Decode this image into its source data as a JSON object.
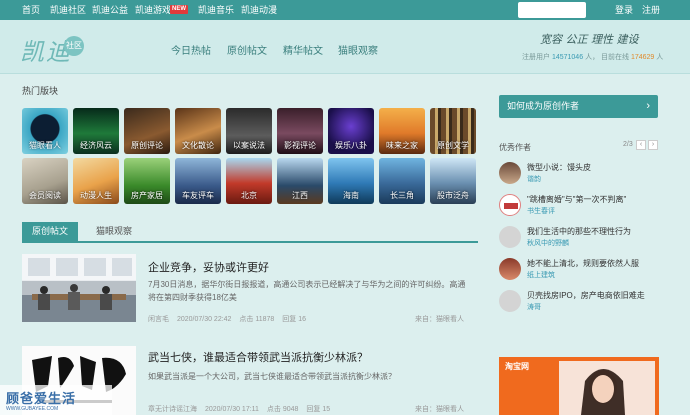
{
  "topnav": {
    "items": [
      "首页",
      "凯迪社区",
      "凯迪公益",
      "凯迪游戏",
      "凯迪音乐",
      "凯迪动漫"
    ],
    "new_badge": "NEW",
    "login": "登录",
    "register": "注册"
  },
  "header": {
    "logo_text": "凯迪",
    "logo_badge": "社区",
    "nav": [
      "今日热帖",
      "原创帖文",
      "精华帖文",
      "猫眼观察"
    ],
    "slogan": "宽容 公正 理性 建设",
    "stats": {
      "registered_label": "注册用户",
      "registered_value": "14571046",
      "unit1": "人",
      "online_label": "目前在线",
      "online_value": "174629",
      "unit2": "人"
    }
  },
  "hot_boards": {
    "title": "热门版块",
    "items": [
      "猫眼看人",
      "经济风云",
      "原创评论",
      "文化散论",
      "以案说法",
      "影视评论",
      "娱乐八卦",
      "味来之家",
      "原创文学",
      "会员阅读",
      "动漫人生",
      "房产家居",
      "车友评车",
      "北京",
      "江西",
      "海南",
      "长三角",
      "股市泛舟"
    ]
  },
  "tabs": [
    "原创帖文",
    "猫眼观察"
  ],
  "articles": [
    {
      "title": "企业竞争，妥协或许更好",
      "summary": "7月30日消息，据华尔街日报报道，高通公司表示已经解决了与华为之间的许可纠纷。高通将在第四财季获得18亿美",
      "author": "闲言毛",
      "time": "2020/07/30 22:42",
      "clicks": "点击 11878",
      "replies": "回复 16",
      "from": "来自：猫眼看人"
    },
    {
      "title": "武当七侠，谁最适合带领武当派抗衡少林派？",
      "summary": "如果武当派是一个大公司，武当七侠谁最适合带领武当派抗衡少林派？",
      "author": "章无计诗谣江海",
      "time": "2020/07/30 17:11",
      "clicks": "点击 9048",
      "replies": "回复 15",
      "from": "来自：猫眼看人"
    }
  ],
  "sidebar": {
    "cta": "如何成为原创作者",
    "authors_title": "优秀作者",
    "pager": "2/3",
    "prev": "‹",
    "next": "›",
    "authors": [
      {
        "name": "微型小说：馒头皮",
        "tag": "谐韵"
      },
      {
        "name": "\"跳槽离婚\"与\"第一次不判离\"",
        "tag": "书生春评"
      },
      {
        "name": "我们生活中的那些不理性行为",
        "tag": "秋风中的野麟"
      },
      {
        "name": "她不能上清北，规则要依然人服",
        "tag": "纸上建筑"
      },
      {
        "name": "贝壳找房IPO，房产电商依旧难走",
        "tag": "涛哥"
      }
    ],
    "ad_brand": "淘宝网"
  },
  "watermark": {
    "main": "顾爸爱生活",
    "sub": "WWW.GUBAYEE.COM"
  },
  "colors": {
    "teal": "#3c9a98",
    "page_bg": "#dcefee"
  }
}
